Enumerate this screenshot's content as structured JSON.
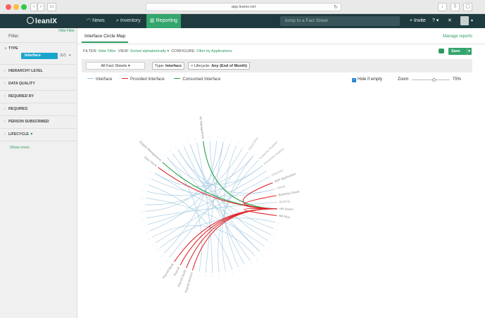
{
  "browser": {
    "url": "app.leanix.net",
    "back_glyph": "‹",
    "forward_glyph": "›",
    "sidebar_glyph": "▭",
    "reload_glyph": "↻"
  },
  "header": {
    "logo_text": "leanIX",
    "nav": [
      {
        "label": "News",
        "icon": "rss-icon",
        "glyph": "◠"
      },
      {
        "label": "Inventory",
        "icon": "search-icon",
        "glyph": "⌕"
      },
      {
        "label": "Reporting",
        "icon": "chart-icon",
        "glyph": "▥"
      }
    ],
    "search_placeholder": "Jump to a Fact Sheet",
    "invite_label": "+ Invite",
    "help_glyph": "?",
    "caret_glyph": "▾",
    "expand_glyph": "✕"
  },
  "sidebar": {
    "hide_filter": "Hide Filter",
    "title": "Filter",
    "type_facet": {
      "label": "TYPE",
      "pill": "Interface",
      "count": "(62)",
      "caret": "▾"
    },
    "facets": [
      "HIERARCHY LEVEL",
      "DATA QUALITY",
      "REQUIRED BY",
      "REQUIRES",
      "PERSON SUBSCRIBED",
      "LIFECYCLE"
    ],
    "show_more": "Show more",
    "chev_open": "∨",
    "chev_closed": "›",
    "funnel_glyph": "▼"
  },
  "main": {
    "tab": "Interface Circle Map",
    "manage_reports": "Manage reports",
    "filter_line": {
      "filter_label": "FILTER:",
      "filter_value": "Hide Filter",
      "view_label": "VIEW:",
      "view_value": "Sorted alphabetically ▾",
      "configure_label": "CONFIGURE:",
      "configure_value": "Filter by Applications"
    },
    "save_label": "Save",
    "save_caret": "▾",
    "fact_sheet_select": "All Fact Sheets ▾",
    "chips": [
      {
        "prefix": "Type: ",
        "value": "Interface",
        "close": ""
      },
      {
        "prefix": "× Lifecycle: ",
        "value": "Any (End of Month)",
        "close": ""
      }
    ],
    "legend": [
      {
        "label": "Interface",
        "color": "#9ec6de"
      },
      {
        "label": "Provided Interface",
        "color": "#e0262b"
      },
      {
        "label": "Consumed Interface",
        "color": "#21a34a"
      }
    ],
    "hide_if_empty": "Hide if empty",
    "check_glyph": "✓",
    "zoom_label": "Zoom",
    "zoom_value": "75%",
    "zoom_fraction": 0.6
  },
  "chart_data": {
    "type": "chord",
    "highlight_colors": {
      "muted": "#a9a9a9",
      "provided": "#e0262b",
      "consumed": "#21a34a",
      "focus": "#111111"
    },
    "nodes": [
      {
        "label": "AC Management",
        "state": "consumed"
      },
      {
        "label": "...",
        "state": "muted"
      },
      {
        "label": "...",
        "state": "muted"
      },
      {
        "label": "...",
        "state": "muted"
      },
      {
        "label": "...",
        "state": "muted"
      },
      {
        "label": "...",
        "state": "muted"
      },
      {
        "label": "...",
        "state": "muted"
      },
      {
        "label": "Cloud Docs",
        "state": "muted"
      },
      {
        "label": "...",
        "state": "muted"
      },
      {
        "label": "Customer Analysis",
        "state": "muted"
      },
      {
        "label": "Document Analysis",
        "state": "muted"
      },
      {
        "label": "...",
        "state": "muted"
      },
      {
        "label": "Checkout",
        "state": "muted"
      },
      {
        "label": "ERP Application",
        "state": "provided"
      },
      {
        "label": "eShop",
        "state": "muted"
      },
      {
        "label": "Banking Check",
        "state": "provided"
      },
      {
        "label": "Banking",
        "state": "muted"
      },
      {
        "label": "HR Admin",
        "state": "focus"
      },
      {
        "label": "HR Plus",
        "state": "provided"
      },
      {
        "label": "...",
        "state": "muted"
      },
      {
        "label": "...",
        "state": "muted"
      },
      {
        "label": "...",
        "state": "muted"
      },
      {
        "label": "...",
        "state": "muted"
      },
      {
        "label": "...",
        "state": "muted"
      },
      {
        "label": "...",
        "state": "muted"
      },
      {
        "label": "...",
        "state": "muted"
      },
      {
        "label": "...",
        "state": "muted"
      },
      {
        "label": "...",
        "state": "muted"
      },
      {
        "label": "...",
        "state": "muted"
      },
      {
        "label": "...",
        "state": "muted"
      },
      {
        "label": "...",
        "state": "muted"
      },
      {
        "label": "...",
        "state": "muted"
      },
      {
        "label": "...",
        "state": "muted"
      },
      {
        "label": "...",
        "state": "muted"
      },
      {
        "label": "...",
        "state": "muted"
      },
      {
        "label": "Payroll Service",
        "state": "provided"
      },
      {
        "label": "Payroll Audit",
        "state": "provided"
      },
      {
        "label": "Payroll",
        "state": "provided"
      },
      {
        "label": "Payroll Bank",
        "state": "provided"
      },
      {
        "label": "...",
        "state": "muted"
      },
      {
        "label": "...",
        "state": "muted"
      },
      {
        "label": "...",
        "state": "muted"
      },
      {
        "label": "...",
        "state": "muted"
      },
      {
        "label": "...",
        "state": "muted"
      },
      {
        "label": "...",
        "state": "muted"
      },
      {
        "label": "...",
        "state": "muted"
      },
      {
        "label": "...",
        "state": "muted"
      },
      {
        "label": "...",
        "state": "muted"
      },
      {
        "label": "...",
        "state": "muted"
      },
      {
        "label": "...",
        "state": "muted"
      },
      {
        "label": "...",
        "state": "muted"
      },
      {
        "label": "...",
        "state": "muted"
      },
      {
        "label": "...",
        "state": "muted"
      },
      {
        "label": "...",
        "state": "muted"
      },
      {
        "label": "Time Track",
        "state": "provided"
      },
      {
        "label": "Supply Management",
        "state": "consumed"
      },
      {
        "label": "...",
        "state": "muted"
      },
      {
        "label": "...",
        "state": "muted"
      },
      {
        "label": "...",
        "state": "muted"
      },
      {
        "label": "...",
        "state": "muted"
      },
      {
        "label": "...",
        "state": "muted"
      },
      {
        "label": "...",
        "state": "muted"
      }
    ],
    "focus_node": 17,
    "links": [
      {
        "source": 17,
        "target": 0,
        "type": "consumed"
      },
      {
        "source": 17,
        "target": 55,
        "type": "consumed"
      },
      {
        "source": 17,
        "target": 13,
        "type": "provided"
      },
      {
        "source": 17,
        "target": 15,
        "type": "provided"
      },
      {
        "source": 17,
        "target": 18,
        "type": "provided"
      },
      {
        "source": 17,
        "target": 35,
        "type": "provided"
      },
      {
        "source": 17,
        "target": 36,
        "type": "provided"
      },
      {
        "source": 17,
        "target": 37,
        "type": "provided"
      },
      {
        "source": 17,
        "target": 38,
        "type": "provided"
      },
      {
        "source": 17,
        "target": 54,
        "type": "provided"
      },
      {
        "source": 2,
        "target": 40,
        "type": "interface"
      },
      {
        "source": 4,
        "target": 44,
        "type": "interface"
      },
      {
        "source": 6,
        "target": 48,
        "type": "interface"
      },
      {
        "source": 8,
        "target": 30,
        "type": "interface"
      },
      {
        "source": 10,
        "target": 50,
        "type": "interface"
      },
      {
        "source": 12,
        "target": 42,
        "type": "interface"
      },
      {
        "source": 14,
        "target": 52,
        "type": "interface"
      },
      {
        "source": 16,
        "target": 46,
        "type": "interface"
      },
      {
        "source": 20,
        "target": 58,
        "type": "interface"
      },
      {
        "source": 22,
        "target": 60,
        "type": "interface"
      },
      {
        "source": 24,
        "target": 57,
        "type": "interface"
      },
      {
        "source": 26,
        "target": 59,
        "type": "interface"
      },
      {
        "source": 28,
        "target": 5,
        "type": "interface"
      },
      {
        "source": 31,
        "target": 9,
        "type": "interface"
      },
      {
        "source": 33,
        "target": 3,
        "type": "interface"
      },
      {
        "source": 1,
        "target": 27,
        "type": "interface"
      },
      {
        "source": 7,
        "target": 39,
        "type": "interface"
      },
      {
        "source": 11,
        "target": 45,
        "type": "interface"
      },
      {
        "source": 19,
        "target": 41,
        "type": "interface"
      },
      {
        "source": 21,
        "target": 53,
        "type": "interface"
      },
      {
        "source": 23,
        "target": 49,
        "type": "interface"
      },
      {
        "source": 25,
        "target": 43,
        "type": "interface"
      },
      {
        "source": 29,
        "target": 51,
        "type": "interface"
      },
      {
        "source": 32,
        "target": 61,
        "type": "interface"
      },
      {
        "source": 34,
        "target": 56,
        "type": "interface"
      },
      {
        "source": 47,
        "target": 3,
        "type": "interface"
      },
      {
        "source": 56,
        "target": 10,
        "type": "interface"
      },
      {
        "source": 58,
        "target": 14,
        "type": "interface"
      },
      {
        "source": 60,
        "target": 24,
        "type": "interface"
      },
      {
        "source": 53,
        "target": 8,
        "type": "interface"
      }
    ]
  }
}
